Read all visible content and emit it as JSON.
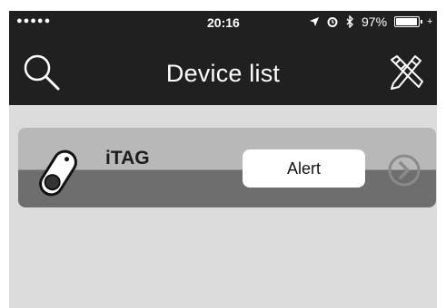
{
  "status_bar": {
    "signal": "●●●●●",
    "time": "20:16",
    "location_icon": "location-arrow-icon",
    "alarm_icon": "alarm-clock-icon",
    "bluetooth_icon": "bluetooth-icon",
    "battery_percent": "97%",
    "battery_icon": "battery-icon",
    "charging": "+"
  },
  "nav_bar": {
    "title": "Device list",
    "left_icon": "search-icon",
    "right_icon": "edit-pencil-icon"
  },
  "devices": [
    {
      "name": "iTAG",
      "icon": "itag-device-icon",
      "action_label": "Alert",
      "chevron_icon": "chevron-right-circle-icon"
    }
  ],
  "colors": {
    "header_bg": "#202020",
    "content_bg": "#dcdcdc",
    "row_top": "#b8b8b8",
    "row_bottom": "#6e6e6e"
  }
}
